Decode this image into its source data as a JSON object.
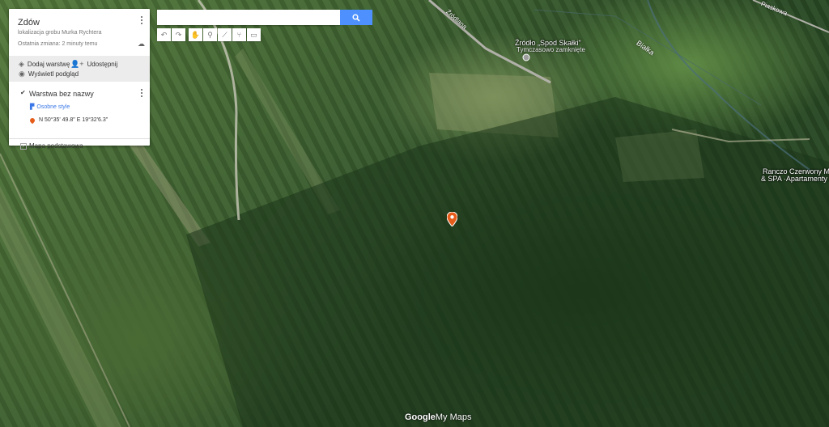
{
  "map": {
    "title": "Zdów",
    "description": "lokalizacja grobu Murka Rychtera",
    "last_change": "Ostatnia zmiana: 2 minuty temu"
  },
  "actions": {
    "add_layer": "Dodaj warstwę",
    "share": "Udostępnij",
    "preview": "Wyświetl podgląd"
  },
  "layer": {
    "name": "Warstwa bez nazwy",
    "style_link": "Osobne style",
    "point_label": "N 50°35' 49.8\" E 19°32'6.3\""
  },
  "base_map": {
    "label": "Mapa podstawowa"
  },
  "search": {
    "placeholder": ""
  },
  "toolbar": {
    "icons": [
      "undo-icon",
      "redo-icon",
      "hand-icon",
      "marker-icon",
      "line-icon",
      "directions-icon",
      "ruler-icon"
    ]
  },
  "map_labels": {
    "spring_name": "Źródło „Spod Skałki\"",
    "spring_status": "Tymczasowo zamknięte",
    "river": "Białka",
    "road_top_left": "Źródlana",
    "road_top_right": "Piaskowa",
    "hotel_line1": "Ranczo Czerwony Młyn",
    "hotel_line2": "& SPA ·Apartamenty z"
  },
  "logo": {
    "brand": "Google",
    "product": "My Maps"
  },
  "colors": {
    "accent": "#4d90fe",
    "marker": "#e65c1a",
    "link": "#3b78e7"
  }
}
